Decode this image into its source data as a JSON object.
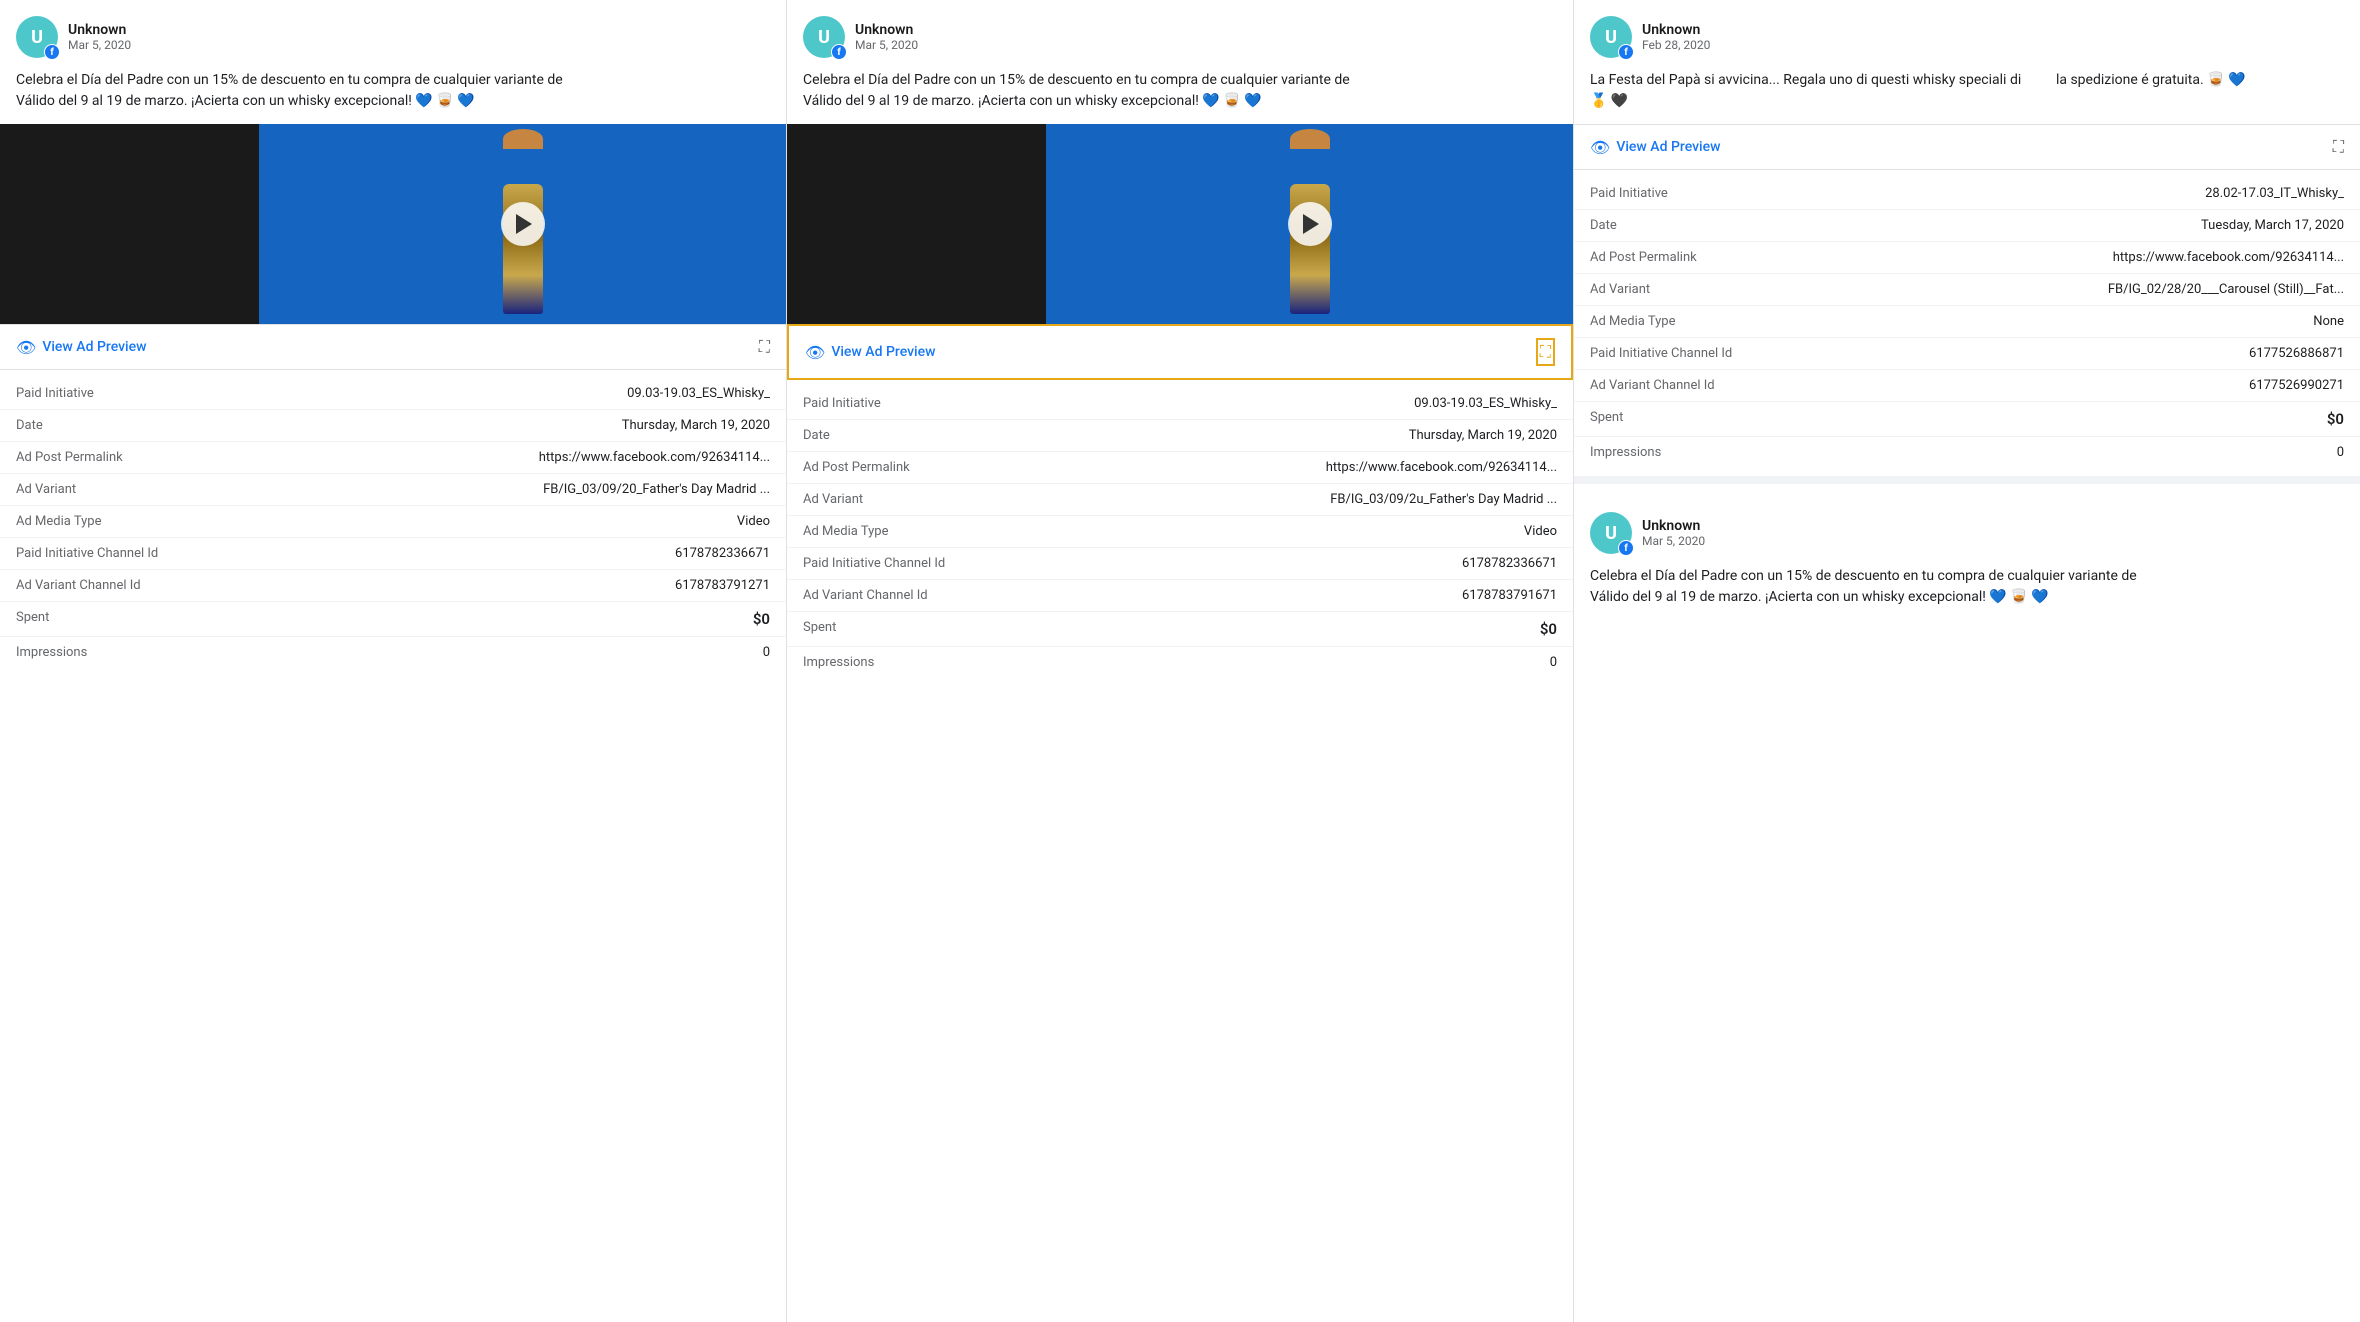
{
  "cards": [
    {
      "id": "card1",
      "user": {
        "name": "Unknown",
        "initial": "U",
        "date": "Mar 5, 2020"
      },
      "post_text": "Celebra el Día del Padre con un 15% de descuento en tu compra de cualquier variante de\nVálido del 9 al 19 de marzo. ¡Acierta con un whisky excepcional! 💙 🥃 💙",
      "view_ad_label": "View Ad Preview",
      "highlighted": false,
      "details": [
        {
          "label": "Paid Initiative",
          "value": "09.03-19.03_ES_Whisky_"
        },
        {
          "label": "Date",
          "value": "Thursday, March 19, 2020"
        },
        {
          "label": "Ad Post Permalink",
          "value": "https://www.facebook.com/92634114..."
        },
        {
          "label": "Ad Variant",
          "value": "FB/IG_03/09/20_Father's Day Madrid ..."
        },
        {
          "label": "Ad Media Type",
          "value": "Video"
        },
        {
          "label": "Paid Initiative Channel Id",
          "value": "6178782336671"
        },
        {
          "label": "Ad Variant Channel Id",
          "value": "6178783791271"
        }
      ],
      "spent": "$0",
      "impressions": "0"
    },
    {
      "id": "card2",
      "user": {
        "name": "Unknown",
        "initial": "U",
        "date": "Mar 5, 2020"
      },
      "post_text": "Celebra el Día del Padre con un 15% de descuento en tu compra de cualquier variante de\nVálido del 9 al 19 de marzo. ¡Acierta con un whisky excepcional! 💙 🥃 💙",
      "view_ad_label": "View Ad Preview",
      "highlighted": true,
      "details": [
        {
          "label": "Paid Initiative",
          "value": "09.03-19.03_ES_Whisky_"
        },
        {
          "label": "Date",
          "value": "Thursday, March 19, 2020"
        },
        {
          "label": "Ad Post Permalink",
          "value": "https://www.facebook.com/92634114..."
        },
        {
          "label": "Ad Variant",
          "value": "FB/IG_03/09/2u_Father's Day Madrid ..."
        },
        {
          "label": "Ad Media Type",
          "value": "Video"
        },
        {
          "label": "Paid Initiative Channel Id",
          "value": "6178782336671"
        },
        {
          "label": "Ad Variant Channel Id",
          "value": "6178783791671"
        }
      ],
      "spent": "$0",
      "impressions": "0"
    },
    {
      "id": "card3",
      "user": {
        "name": "Unknown",
        "initial": "U",
        "date": "Feb 28, 2020"
      },
      "post_text": "La Festa del Papà si avvicina... Regala uno di questi whisky speciali di                la spedizione é gratuita. 🥃 💙\n🥇 🖤",
      "view_ad_label": "View Ad Preview",
      "highlighted": false,
      "details": [
        {
          "label": "Paid Initiative",
          "value": "28.02-17.03_IT_Whisky_"
        },
        {
          "label": "Date",
          "value": "Tuesday, March 17, 2020"
        },
        {
          "label": "Ad Post Permalink",
          "value": "https://www.facebook.com/92634114..."
        },
        {
          "label": "Ad Variant",
          "value": "FB/IG_02/28/20___Carousel (Still)__Fat..."
        },
        {
          "label": "Ad Media Type",
          "value": "None"
        },
        {
          "label": "Paid Initiative Channel Id",
          "value": "6177526886871"
        },
        {
          "label": "Ad Variant Channel Id",
          "value": "6177526990271"
        }
      ],
      "spent": "$0",
      "impressions": "0",
      "second_post": {
        "user": {
          "name": "Unknown",
          "initial": "U",
          "date": "Mar 5, 2020"
        },
        "post_text": "Celebra el Día del Padre con un 15% de descuento en tu compra de cualquier variante de\nVálido del 9 al 19 de marzo. ¡Acierta con un whisky excepcional! 💙 🥃 💙"
      }
    }
  ],
  "labels": {
    "spent": "Spent",
    "impressions": "Impressions"
  }
}
